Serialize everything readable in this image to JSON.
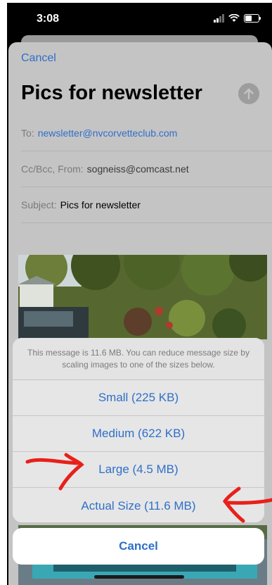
{
  "status_bar": {
    "time": "3:08"
  },
  "compose": {
    "cancel_label": "Cancel",
    "title": "Pics for newsletter",
    "to_label": "To:",
    "to_value": "newsletter@nvcorvetteclub.com",
    "ccbcc_label": "Cc/Bcc, From:",
    "from_value": "sogneiss@comcast.net",
    "subject_label": "Subject:",
    "subject_value": "Pics for newsletter"
  },
  "action_sheet": {
    "message": "This message is 11.6 MB. You can reduce message size by scaling images to one of the sizes below.",
    "options": [
      {
        "label": "Small (225 KB)"
      },
      {
        "label": "Medium (622 KB)"
      },
      {
        "label": "Large (4.5 MB)"
      },
      {
        "label": "Actual Size (11.6 MB)"
      }
    ],
    "cancel_label": "Cancel"
  },
  "colors": {
    "accent": "#2f6fc9",
    "annotation": "#e8201a"
  },
  "icons": [
    "signal-icon",
    "wifi-icon",
    "battery-icon",
    "send-arrow-icon"
  ]
}
